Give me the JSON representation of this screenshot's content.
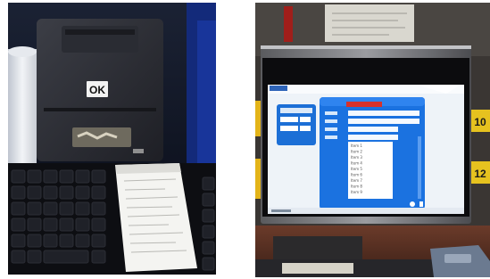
{
  "left_photo": {
    "printer_badge": "OK"
  },
  "right_photo": {
    "screen": {
      "dialog_rows": [
        "Item 1",
        "Item 2",
        "Item 3",
        "Item 4",
        "Item 5",
        "Item 6",
        "Item 7",
        "Item 8",
        "Item 9"
      ]
    },
    "bay_numbers": [
      "10",
      "12"
    ]
  }
}
